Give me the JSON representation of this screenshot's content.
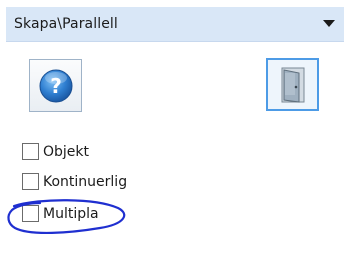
{
  "panel": {
    "title": "Skapa\\Parallell"
  },
  "buttons": {
    "help_icon": "help-question-icon",
    "exit_icon": "exit-door-icon"
  },
  "options": [
    {
      "label": "Objekt",
      "checked": false
    },
    {
      "label": "Kontinuerlig",
      "checked": false
    },
    {
      "label": "Multipla",
      "checked": false
    }
  ],
  "colors": {
    "titlebar": "#d9e7f7",
    "accent_border": "#4d9be6",
    "help_blue": "#2f7fd1",
    "annotation_ink": "#1f2fd0"
  }
}
